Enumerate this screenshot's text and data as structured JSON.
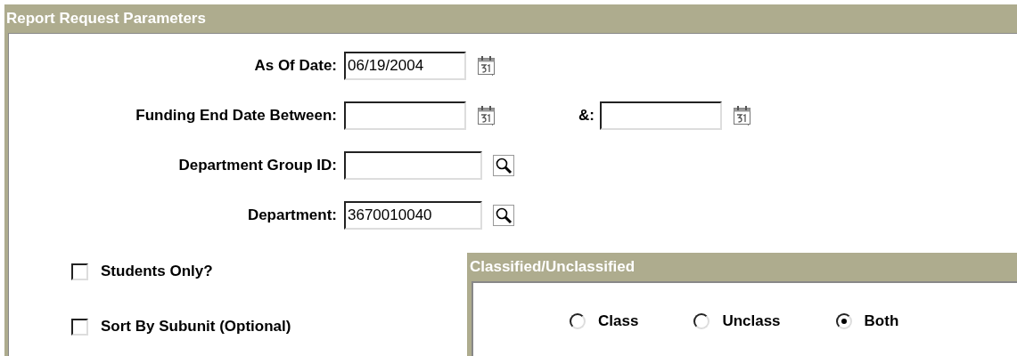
{
  "panel": {
    "title": "Report Request Parameters"
  },
  "fields": [
    {
      "label": "As Of Date:",
      "value": "06/19/2004",
      "kind": "date"
    },
    {
      "label": "Funding End Date Between:",
      "kind": "date",
      "second": {
        "label": "&:"
      }
    },
    {
      "label": "Department Group ID:",
      "kind": "lookup"
    },
    {
      "label": "Department:",
      "value": "3670010040",
      "kind": "lookup"
    }
  ],
  "checkboxes": [
    {
      "label": "Students Only?",
      "checked": false
    },
    {
      "label": "Sort By Subunit (Optional)",
      "checked": false
    }
  ],
  "classification": {
    "title": "Classified/Unclassified",
    "options": [
      {
        "label": "Class",
        "selected": false
      },
      {
        "label": "Unclass",
        "selected": false
      },
      {
        "label": "Both",
        "selected": true
      }
    ]
  }
}
